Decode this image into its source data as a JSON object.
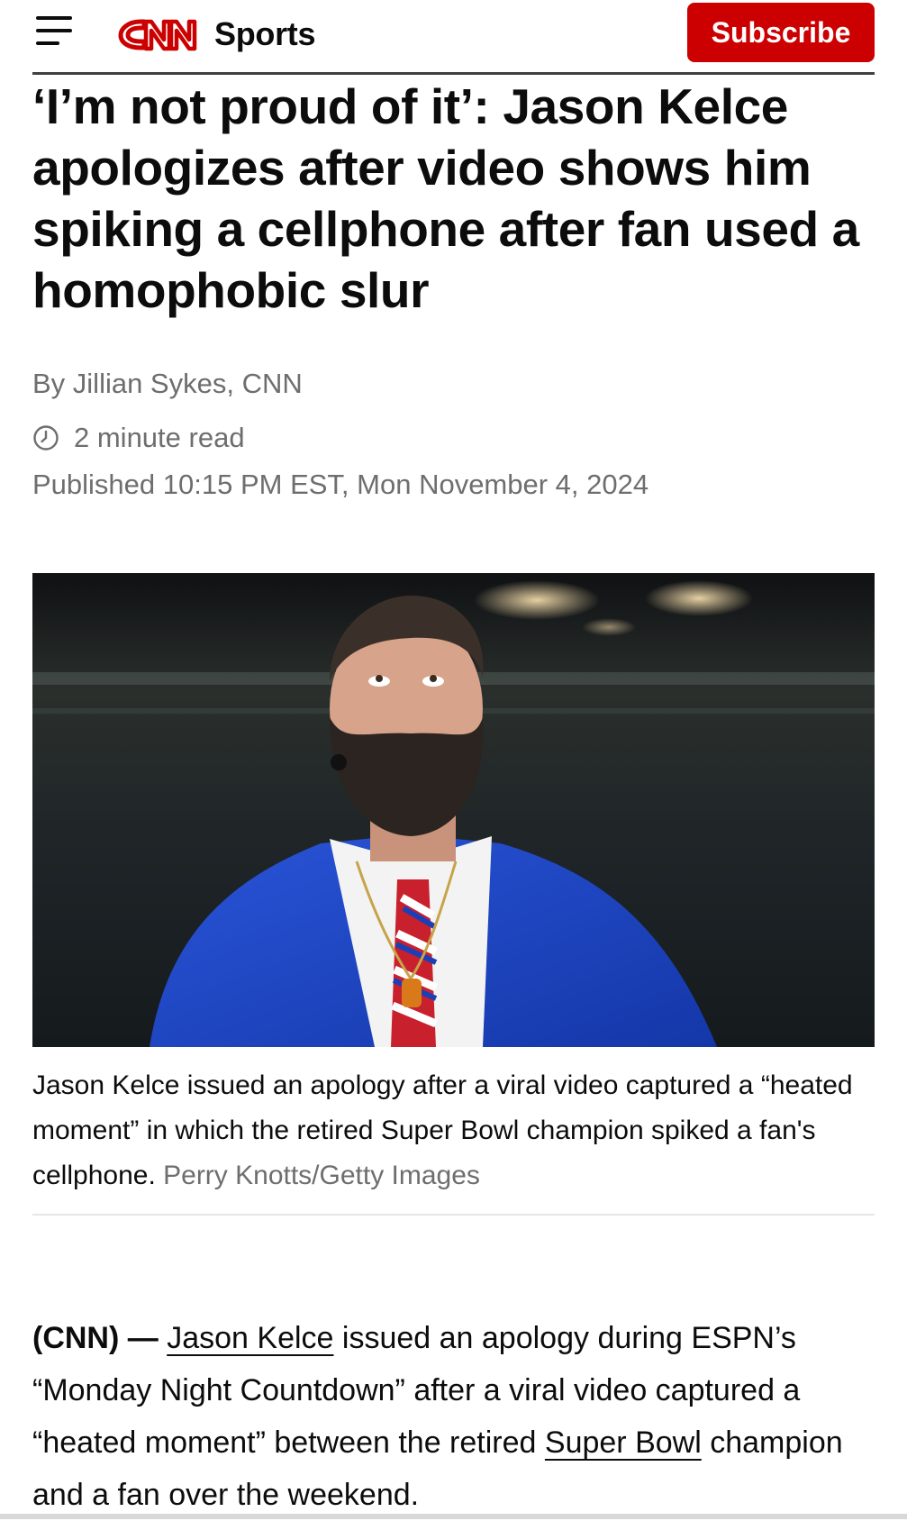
{
  "header": {
    "logo_text": "CNN",
    "section": "Sports",
    "subscribe_label": "Subscribe",
    "brand_color": "#cc0000"
  },
  "article": {
    "headline": "‘I’m not proud of it’: Jason Kelce apologizes after video shows him spiking a cellphone after fan used a homophobic slur",
    "byline": "By Jillian Sykes, CNN",
    "read_time": "2 minute read",
    "published": "Published 10:15 PM EST, Mon November 4, 2024",
    "image_caption": "Jason Kelce issued an apology after a viral video captured a “heated moment” in which the retired Super Bowl champion spiked a fan's cellphone.",
    "image_credit": "Perry Knotts/Getty Images",
    "body": {
      "source": "(CNN) —",
      "link1": "Jason Kelce",
      "text1": "issued an apology during ESPN’s “Monday Night Countdown” after a viral video captured a “heated moment” between the retired",
      "link2": "Super Bowl",
      "text2": "champion and a fan over the weekend."
    }
  },
  "icons": {
    "menu": "hamburger-menu-icon",
    "clock": "clock-icon"
  }
}
